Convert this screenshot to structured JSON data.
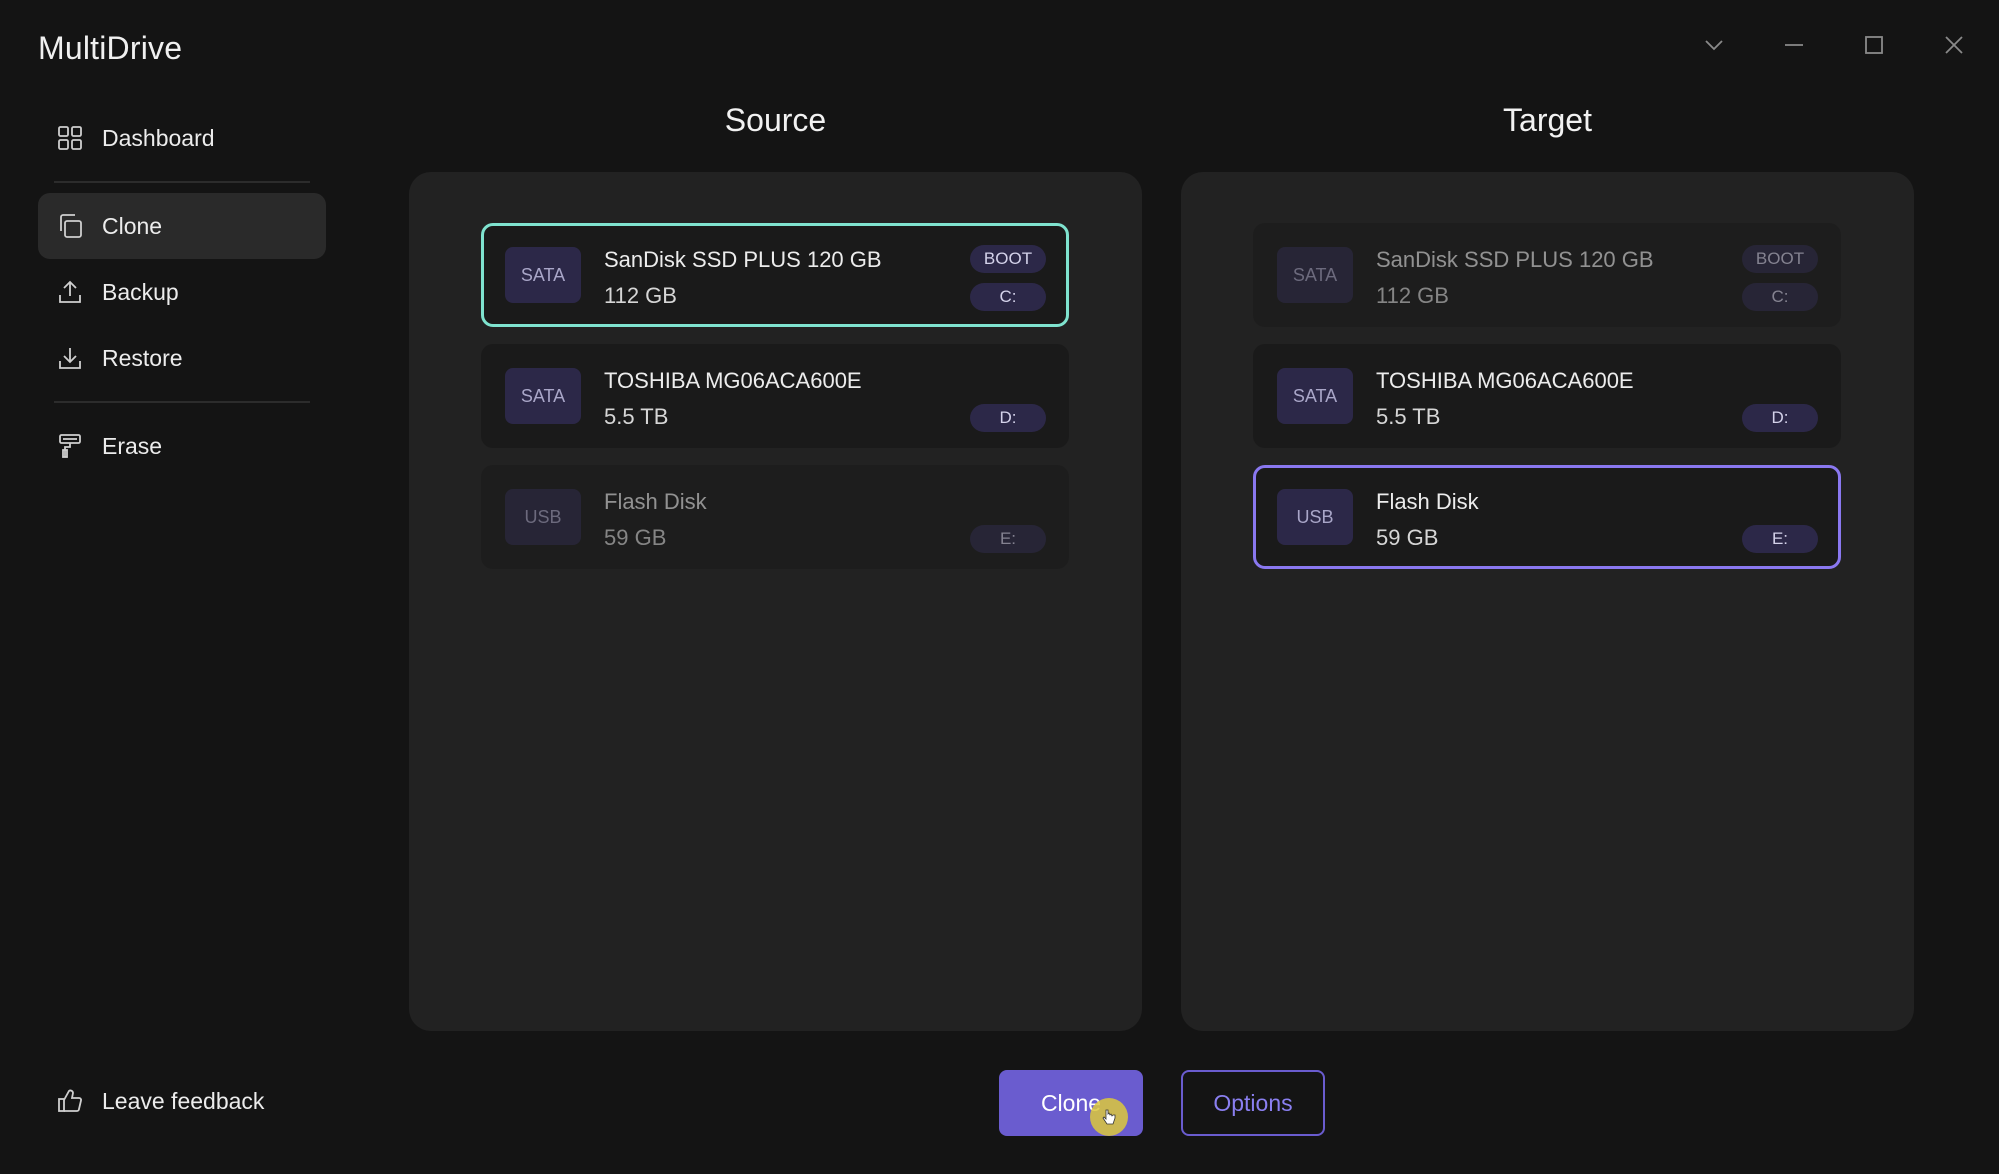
{
  "app": {
    "title": "MultiDrive"
  },
  "window_controls": {
    "dropdown_icon": "chevron-down-icon",
    "minimize_icon": "minimize-icon",
    "maximize_icon": "maximize-icon",
    "close_icon": "close-icon"
  },
  "sidebar": {
    "items": [
      {
        "label": "Dashboard",
        "icon": "grid-icon",
        "active": false
      },
      {
        "label": "Clone",
        "icon": "copy-icon",
        "active": true
      },
      {
        "label": "Backup",
        "icon": "upload-icon",
        "active": false
      },
      {
        "label": "Restore",
        "icon": "download-icon",
        "active": false
      },
      {
        "label": "Erase",
        "icon": "paint-roller-icon",
        "active": false
      }
    ],
    "feedback": {
      "label": "Leave feedback",
      "icon": "thumbs-up-icon"
    }
  },
  "source": {
    "title": "Source",
    "drives": [
      {
        "type": "SATA",
        "name": "SanDisk SSD PLUS 120 GB",
        "size": "112 GB",
        "boot": "BOOT",
        "letter": "C:",
        "state": "selected"
      },
      {
        "type": "SATA",
        "name": "TOSHIBA MG06ACA600E",
        "size": "5.5 TB",
        "letter": "D:",
        "state": "normal"
      },
      {
        "type": "USB",
        "name": "Flash Disk",
        "size": "59 GB",
        "letter": "E:",
        "state": "disabled"
      }
    ]
  },
  "target": {
    "title": "Target",
    "drives": [
      {
        "type": "SATA",
        "name": "SanDisk SSD PLUS 120 GB",
        "size": "112 GB",
        "boot": "BOOT",
        "letter": "C:",
        "state": "disabled"
      },
      {
        "type": "SATA",
        "name": "TOSHIBA MG06ACA600E",
        "size": "5.5 TB",
        "letter": "D:",
        "state": "normal"
      },
      {
        "type": "USB",
        "name": "Flash Disk",
        "size": "59 GB",
        "letter": "E:",
        "state": "selected"
      }
    ]
  },
  "actions": {
    "clone_label": "Clone",
    "options_label": "Options"
  },
  "colors": {
    "source_selected": "#7fe3cf",
    "target_selected": "#8a78f0",
    "accent": "#6a5ccf",
    "background": "#141414",
    "panel": "#222222"
  }
}
